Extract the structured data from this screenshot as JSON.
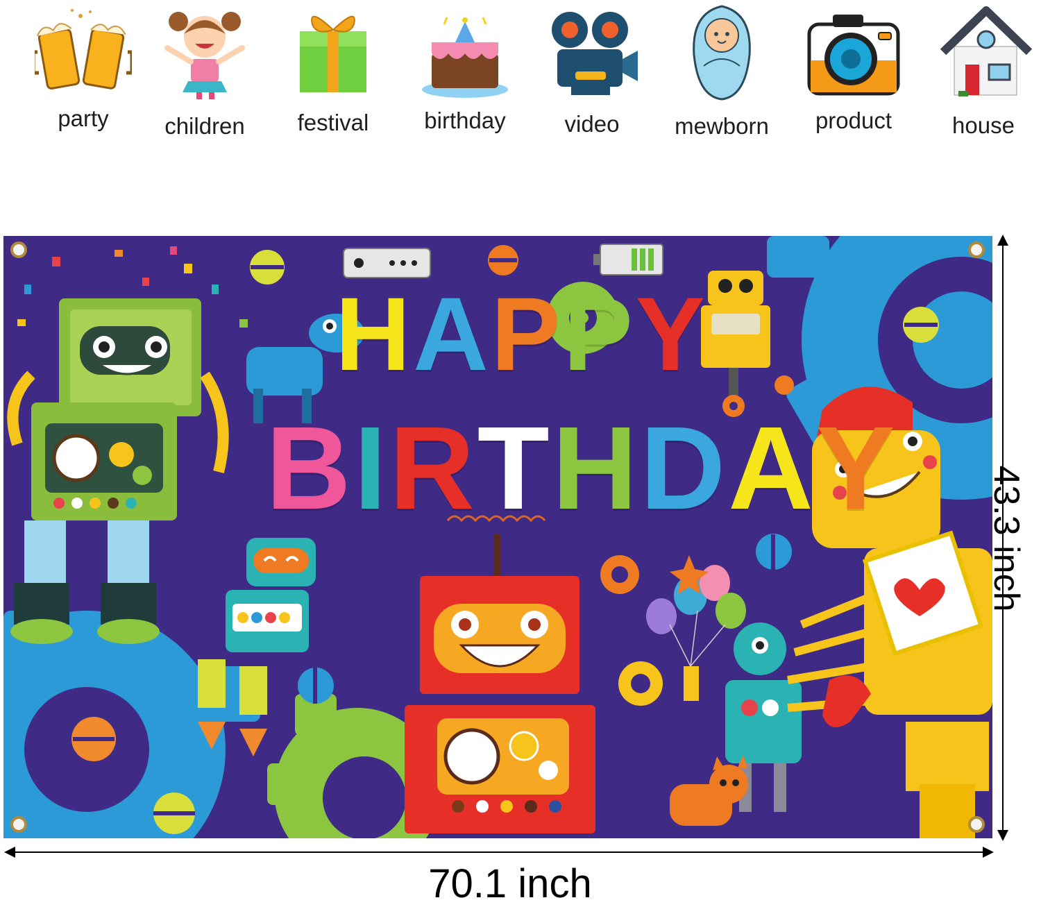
{
  "use_cases": [
    {
      "label": "party",
      "icon": "beer-mugs-icon"
    },
    {
      "label": "children",
      "icon": "child-icon"
    },
    {
      "label": "festival",
      "icon": "gift-box-icon"
    },
    {
      "label": "birthday",
      "icon": "cake-icon"
    },
    {
      "label": "video",
      "icon": "video-camera-icon"
    },
    {
      "label": "mewborn",
      "icon": "swaddled-baby-icon"
    },
    {
      "label": "product",
      "icon": "photo-camera-icon"
    },
    {
      "label": "house",
      "icon": "house-icon"
    }
  ],
  "banner": {
    "line1": [
      "H",
      "A",
      "P",
      "P",
      "Y"
    ],
    "line2": [
      "B",
      "I",
      "R",
      "T",
      "H",
      "D",
      "A",
      "Y"
    ],
    "colors": {
      "background": "#3f2a86",
      "gear_blue": "#2d9ad8",
      "gear_green": "#8cc540",
      "robot_red": "#e63027",
      "robot_yellow": "#f7c41b",
      "robot_green": "#8bbd3c",
      "robot_teal": "#2bb3b3"
    }
  },
  "dimensions": {
    "width": "70.1 inch",
    "height": "43.3 inch"
  }
}
